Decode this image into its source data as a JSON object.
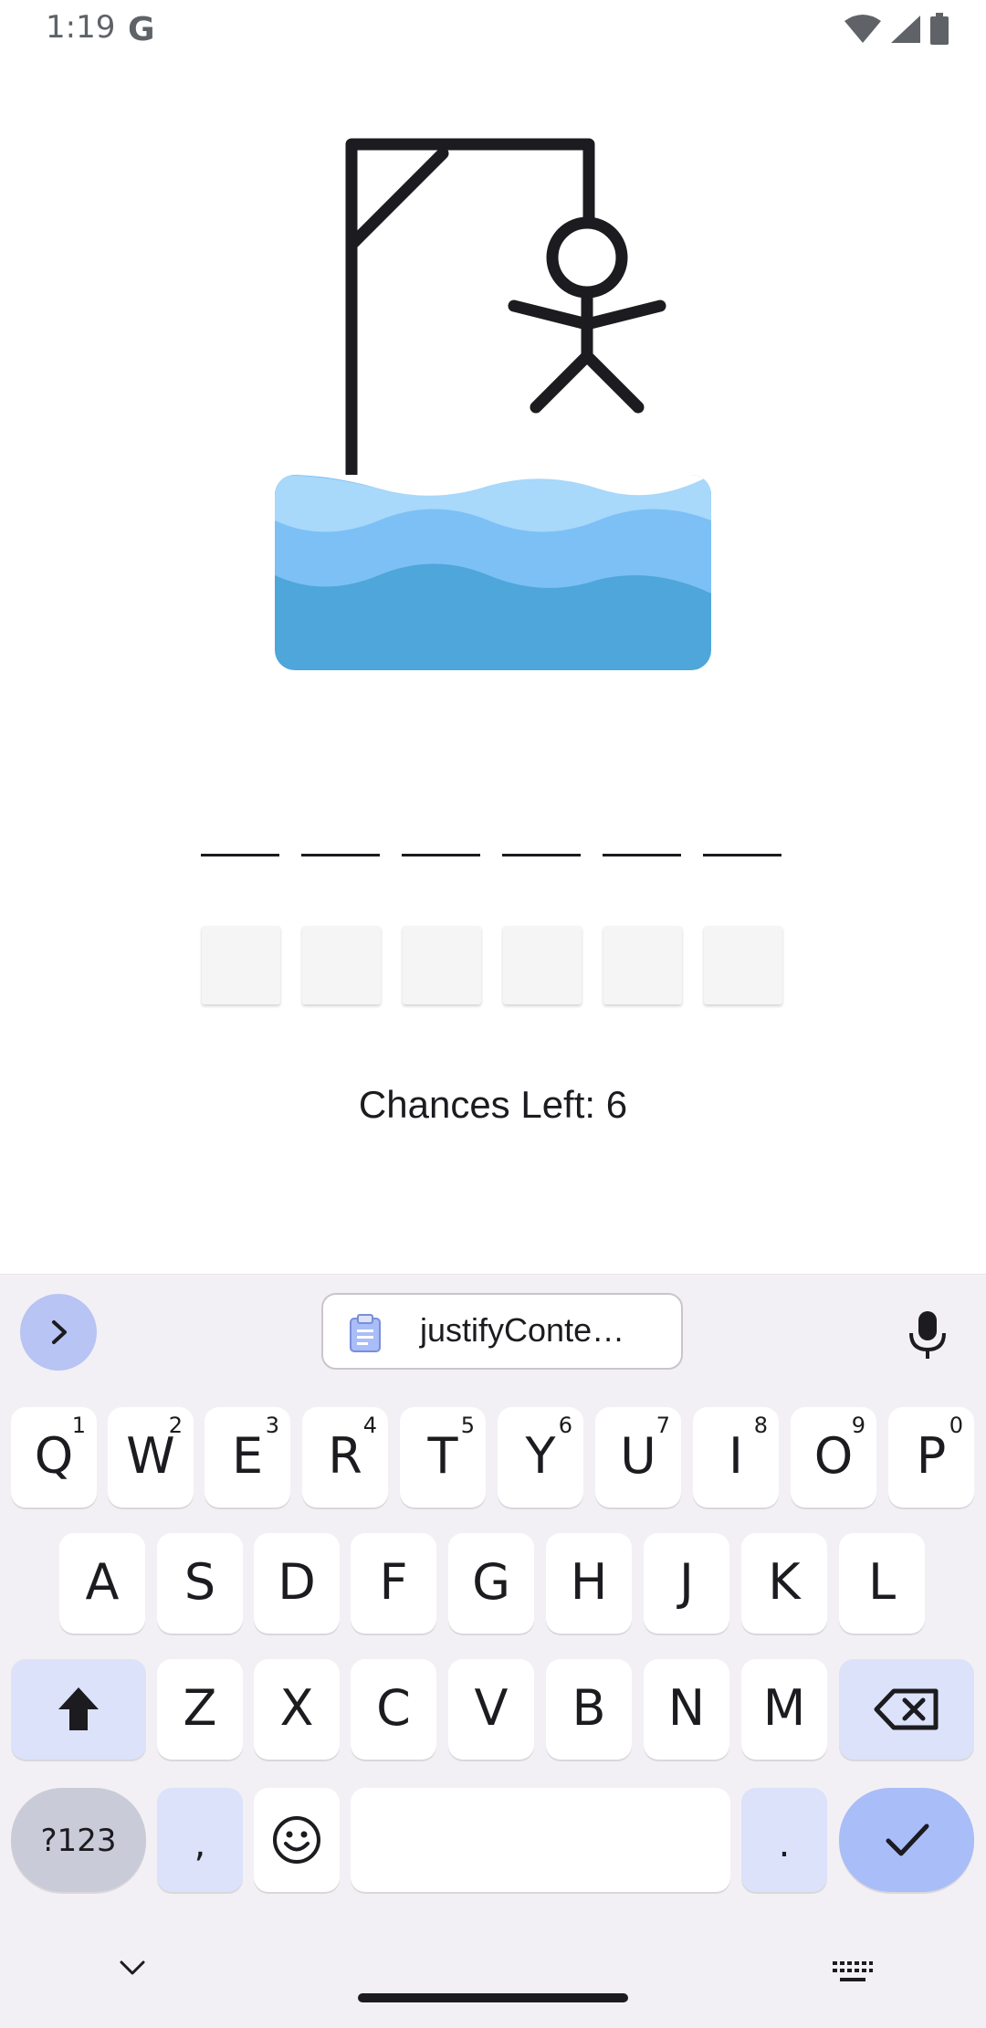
{
  "status_bar": {
    "time": "1:19",
    "google_badge": "G",
    "icons": [
      "wifi-icon",
      "signal-icon",
      "battery-icon"
    ]
  },
  "game": {
    "illustration": "hangman-over-water",
    "word_length": 6,
    "guessed_letters": [
      "",
      "",
      "",
      "",
      "",
      ""
    ],
    "chances_text": "Chances Left: 6"
  },
  "keyboard": {
    "clipboard_text": "justifyConte…",
    "row1": [
      {
        "key": "Q",
        "sup": "1"
      },
      {
        "key": "W",
        "sup": "2"
      },
      {
        "key": "E",
        "sup": "3"
      },
      {
        "key": "R",
        "sup": "4"
      },
      {
        "key": "T",
        "sup": "5"
      },
      {
        "key": "Y",
        "sup": "6"
      },
      {
        "key": "U",
        "sup": "7"
      },
      {
        "key": "I",
        "sup": "8"
      },
      {
        "key": "O",
        "sup": "9"
      },
      {
        "key": "P",
        "sup": "0"
      }
    ],
    "row2": [
      "A",
      "S",
      "D",
      "F",
      "G",
      "H",
      "J",
      "K",
      "L"
    ],
    "row3": [
      "Z",
      "X",
      "C",
      "V",
      "B",
      "N",
      "M"
    ],
    "symbols_label": "?123",
    "comma_label": ",",
    "period_label": "."
  },
  "colors": {
    "water_light": "#a8d8fa",
    "water_mid": "#7cc0f5",
    "water_dark": "#4ea6da",
    "keyboard_bg": "#f3f0f5",
    "accent_key": "#a9bdf8",
    "modifier_key": "#dbe2f9"
  }
}
